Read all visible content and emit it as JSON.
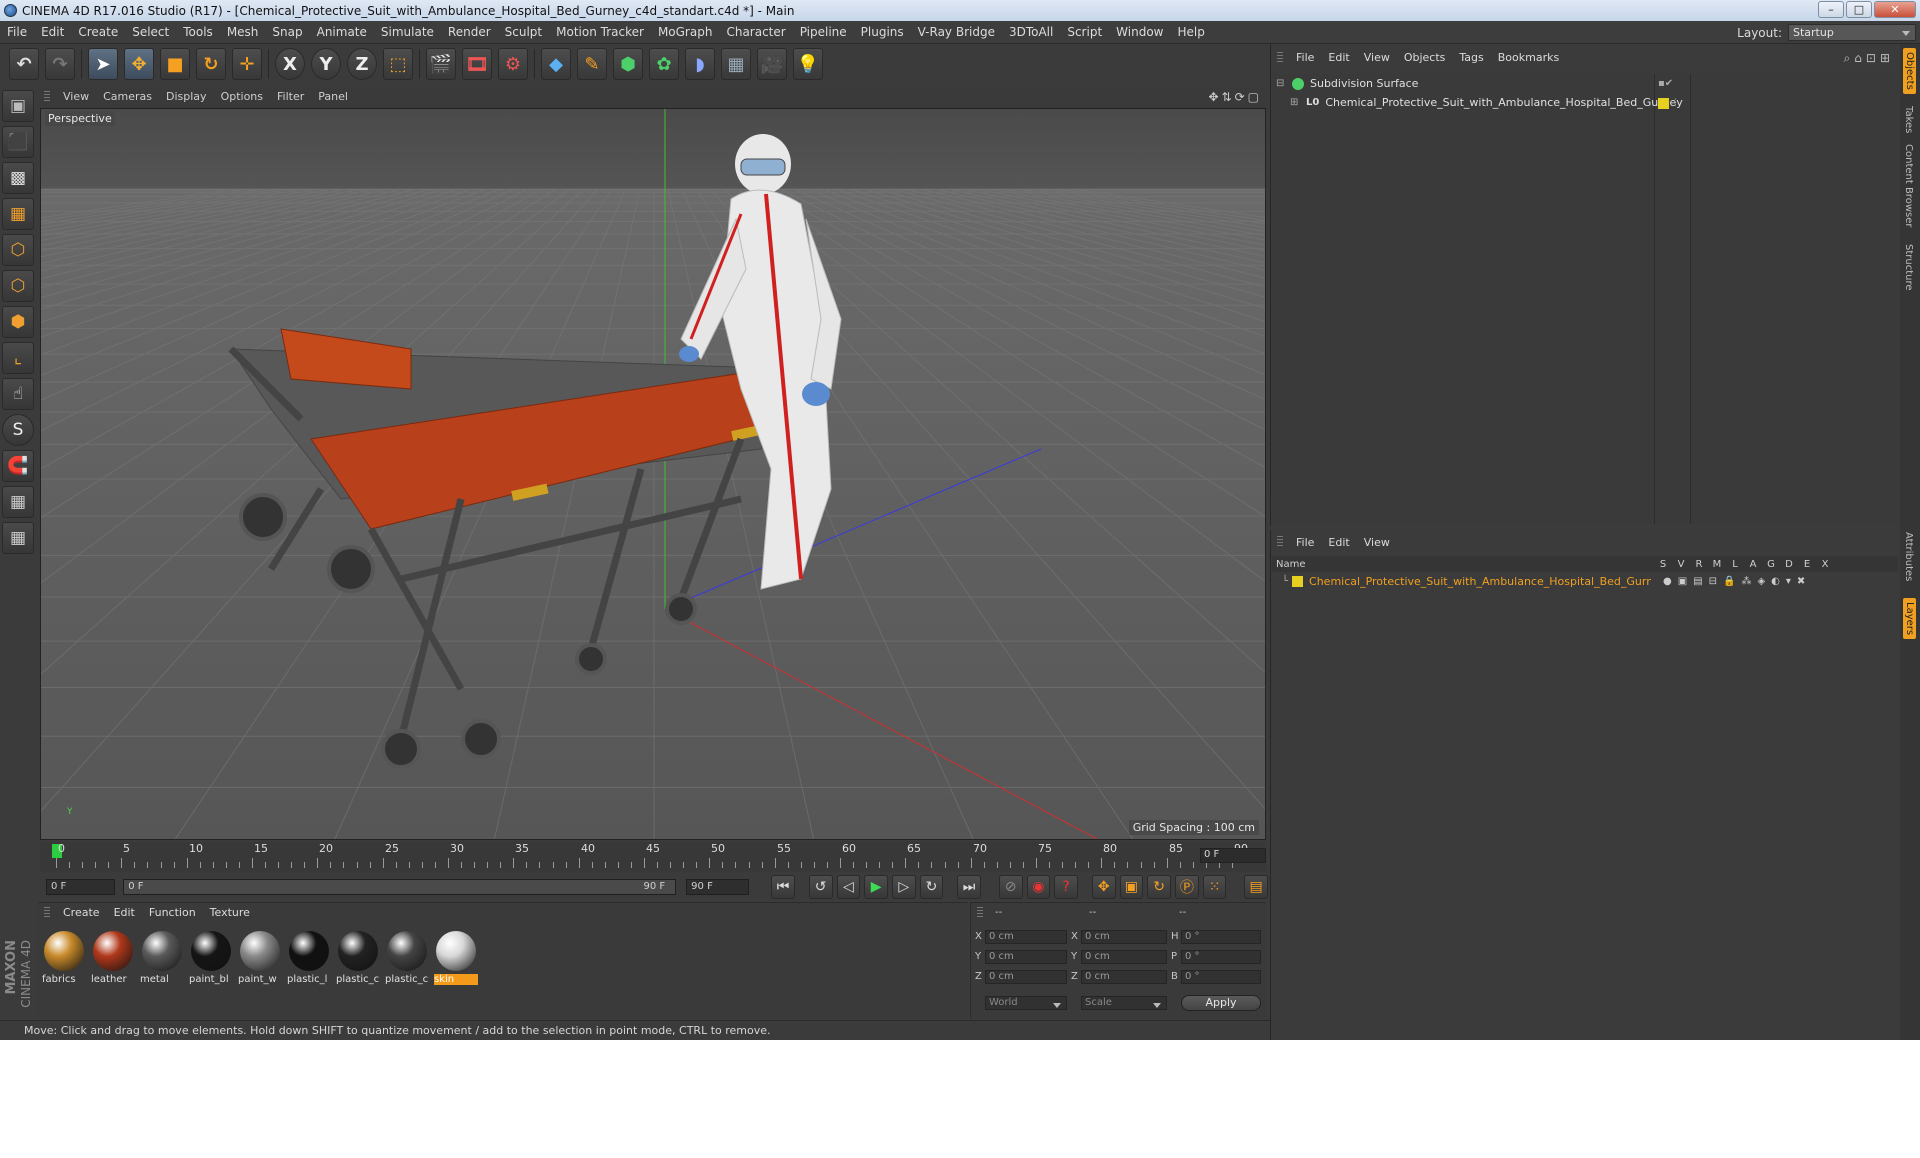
{
  "window": {
    "title": "CINEMA 4D R17.016 Studio (R17) - [Chemical_Protective_Suit_with_Ambulance_Hospital_Bed_Gurney_c4d_standart.c4d *] - Main",
    "min": "–",
    "max": "□",
    "close": "✕"
  },
  "menubar": [
    "File",
    "Edit",
    "Create",
    "Select",
    "Tools",
    "Mesh",
    "Snap",
    "Animate",
    "Simulate",
    "Render",
    "Sculpt",
    "Motion Tracker",
    "MoGraph",
    "Character",
    "Pipeline",
    "Plugins",
    "V-Ray Bridge",
    "3DToAll",
    "Script",
    "Window",
    "Help"
  ],
  "layout": {
    "label": "Layout:",
    "value": "Startup"
  },
  "viewport": {
    "menu": [
      "View",
      "Cameras",
      "Display",
      "Options",
      "Filter",
      "Panel"
    ],
    "label": "Perspective",
    "grid_spacing": "Grid Spacing : 100 cm"
  },
  "timeline": {
    "ticks": [
      "0",
      "5",
      "10",
      "15",
      "20",
      "25",
      "30",
      "35",
      "40",
      "45",
      "50",
      "55",
      "60",
      "65",
      "70",
      "75",
      "80",
      "85",
      "90"
    ],
    "current_frame": "0 F",
    "start_field": "0 F",
    "range_start": "0 F",
    "range_end": "90 F",
    "end_field": "90 F"
  },
  "materials": {
    "menu": [
      "Create",
      "Edit",
      "Function",
      "Texture"
    ],
    "items": [
      {
        "name": "fabrics",
        "color": "#c88a2a"
      },
      {
        "name": "leather",
        "color": "#b0381a"
      },
      {
        "name": "metal",
        "color": "#5a5a5a"
      },
      {
        "name": "paint_bl",
        "color": "#151515"
      },
      {
        "name": "paint_w",
        "color": "#8a8a8a"
      },
      {
        "name": "plastic_l",
        "color": "#111111"
      },
      {
        "name": "plastic_c",
        "color": "#222222"
      },
      {
        "name": "plastic_c",
        "color": "#444444"
      },
      {
        "name": "skin",
        "color": "#d8d8d8"
      }
    ]
  },
  "coords": {
    "headers": [
      "--",
      "--",
      "--"
    ],
    "rows": [
      {
        "a": "X",
        "av": "0 cm",
        "b": "X",
        "bv": "0 cm",
        "c": "H",
        "cv": "0 °"
      },
      {
        "a": "Y",
        "av": "0 cm",
        "b": "Y",
        "bv": "0 cm",
        "c": "P",
        "cv": "0 °"
      },
      {
        "a": "Z",
        "av": "0 cm",
        "b": "Z",
        "bv": "0 cm",
        "c": "B",
        "cv": "0 °"
      }
    ],
    "space": "World",
    "mode": "Scale",
    "apply": "Apply"
  },
  "status": "Move: Click and drag to move elements. Hold down SHIFT to quantize movement / add to the selection in point mode, CTRL to remove.",
  "objects": {
    "menu": [
      "File",
      "Edit",
      "View",
      "Objects",
      "Tags",
      "Bookmarks"
    ],
    "items": [
      "Subdivision Surface",
      "Chemical_Protective_Suit_with_Ambulance_Hospital_Bed_Gurney"
    ]
  },
  "layers": {
    "menu": [
      "File",
      "Edit",
      "View"
    ],
    "name_header": "Name",
    "cols": [
      "S",
      "V",
      "R",
      "M",
      "L",
      "A",
      "G",
      "D",
      "E",
      "X"
    ],
    "items": [
      "Chemical_Protective_Suit_with_Ambulance_Hospital_Bed_Gurney"
    ],
    "accent": "#f0a020"
  },
  "side_tabs": [
    "Objects",
    "Takes",
    "Content Browser",
    "Structure",
    "Attributes",
    "Layers"
  ],
  "brand": [
    "MAXON",
    "CINEMA 4D"
  ]
}
